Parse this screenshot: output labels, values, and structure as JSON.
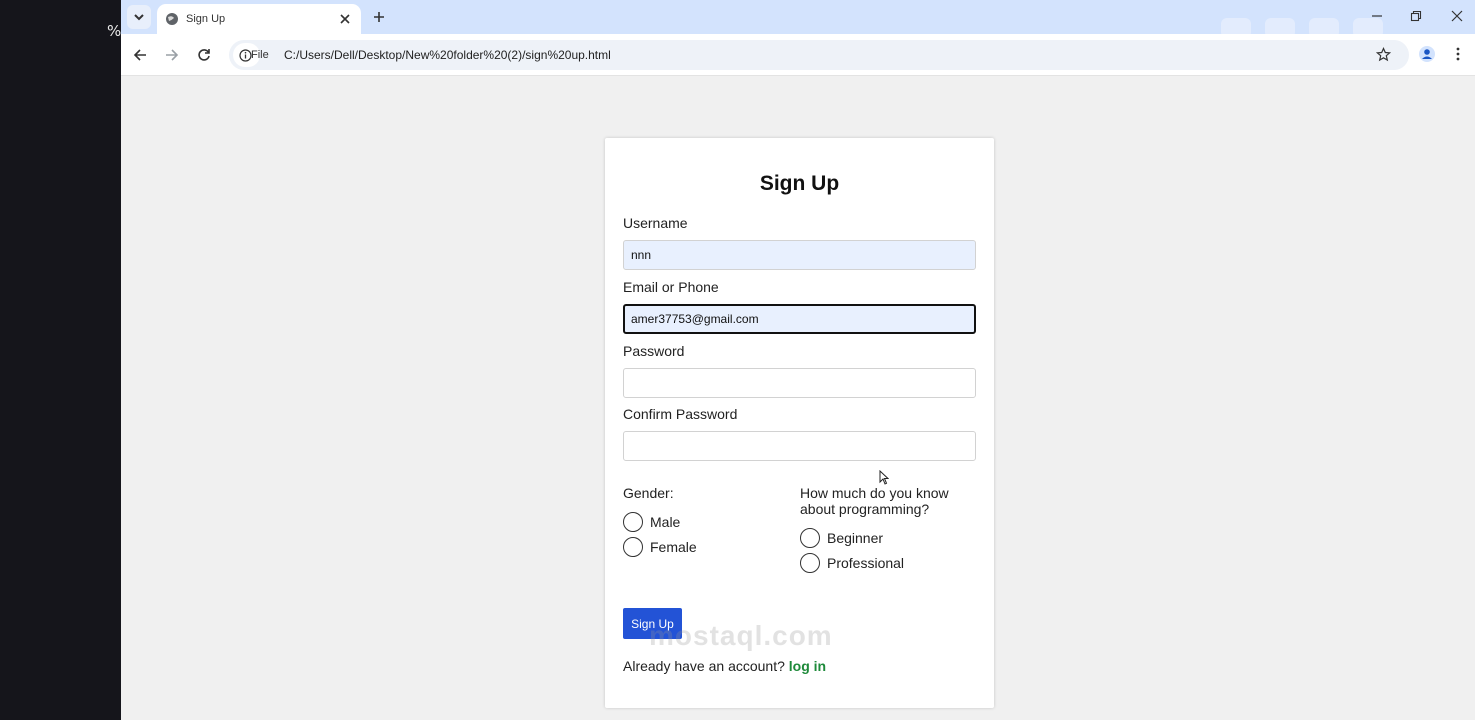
{
  "browser": {
    "tab_title": "Sign Up",
    "chip_label": "File",
    "url": "C:/Users/Dell/Desktop/New%20folder%20(2)/sign%20up.html"
  },
  "form": {
    "heading": "Sign Up",
    "username_label": "Username",
    "username_value": "nnn",
    "email_label": "Email or Phone",
    "email_value": "amer37753@gmail.com",
    "password_label": "Password",
    "confirm_label": "Confirm Password",
    "gender_label": "Gender:",
    "gender_options": [
      "Male",
      "Female"
    ],
    "skill_label_line1": "How much do you know",
    "skill_label_line2": "about programming?",
    "skill_options": [
      "Beginner",
      "Professional"
    ],
    "submit_label": "Sign Up",
    "footer_text": "Already have an account?",
    "footer_link": "log in"
  },
  "watermark": "mostaql.com",
  "left_glyph": "%",
  "colors": {
    "accent": "#2353d6",
    "link": "#1e8a3a",
    "autofill": "#e8f0fe",
    "tabstrip": "#d3e3fd"
  },
  "icons": [
    "tab-search-icon",
    "globe-icon",
    "close-icon",
    "plus-icon",
    "minimize-icon",
    "restore-icon",
    "window-close-icon",
    "back-icon",
    "forward-icon",
    "reload-icon",
    "info-icon",
    "star-icon",
    "profile-icon",
    "menu-icon",
    "cursor-icon"
  ]
}
